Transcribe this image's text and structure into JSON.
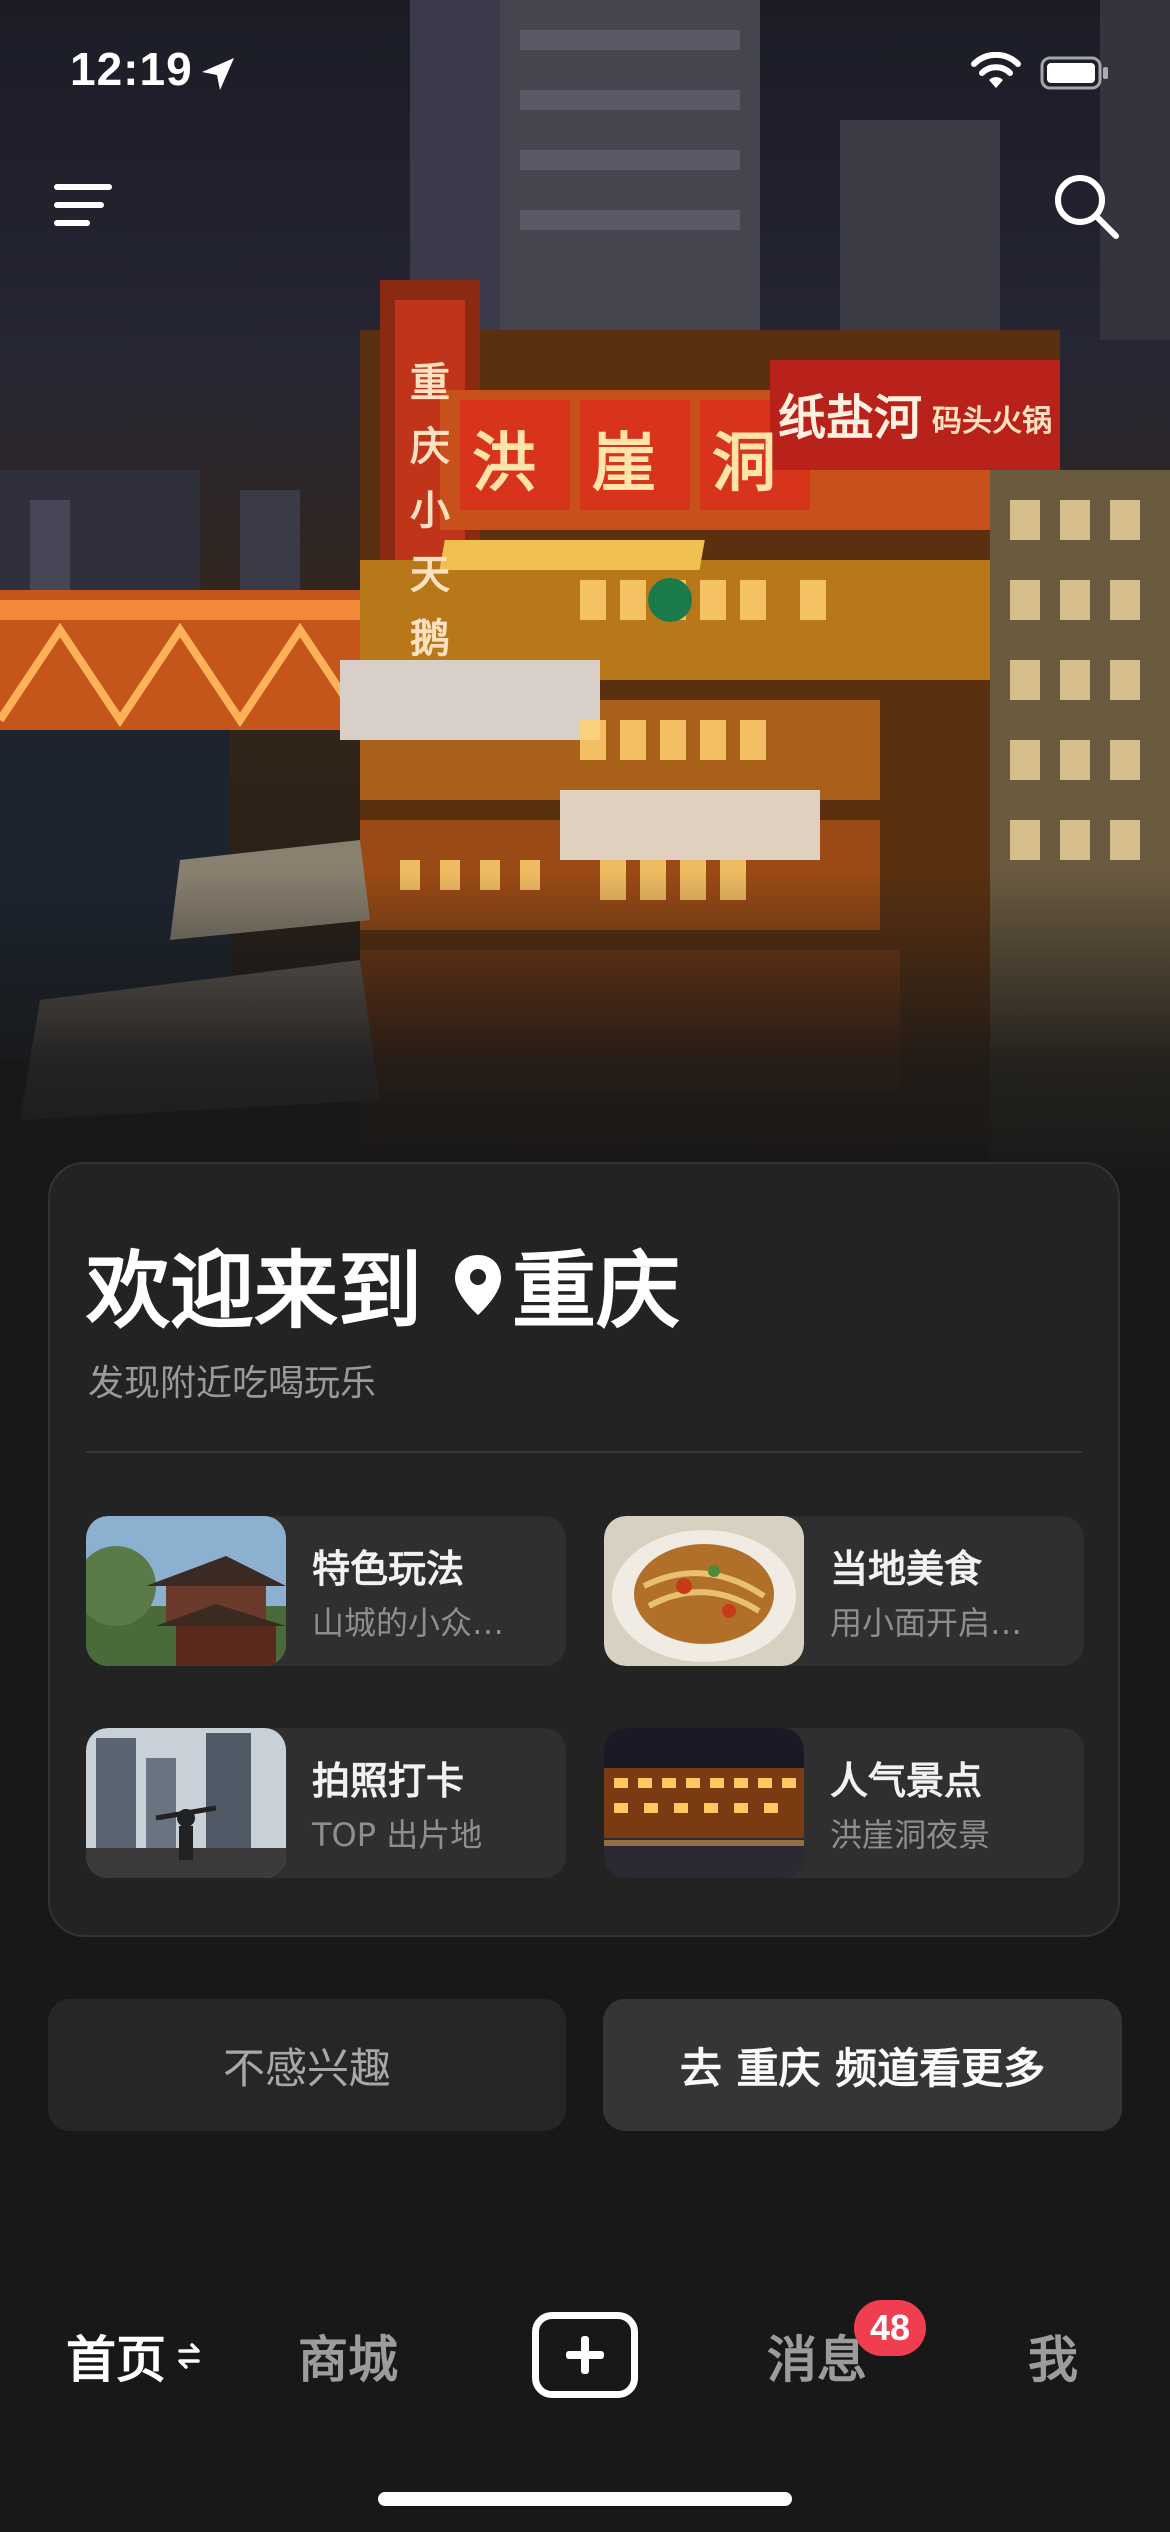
{
  "status_bar": {
    "time": "12:19"
  },
  "header": {
    "menu_icon": "menu-icon",
    "search_icon": "search-icon"
  },
  "hero": {
    "signs": {
      "main": [
        "洪",
        "崖",
        "洞"
      ],
      "vertical": [
        "重",
        "庆",
        "小",
        "天",
        "鹅"
      ],
      "right": "纸盐河",
      "right_small": "码头火锅"
    }
  },
  "welcome": {
    "title_prefix": "欢迎来到",
    "city": "重庆",
    "subtitle": "发现附近吃喝玩乐"
  },
  "categories": [
    {
      "title": "特色玩法",
      "subtitle": "山城的小众…"
    },
    {
      "title": "当地美食",
      "subtitle": "用小面开启…"
    },
    {
      "title": "拍照打卡",
      "subtitle": "TOP 出片地"
    },
    {
      "title": "人气景点",
      "subtitle": "洪崖洞夜景"
    }
  ],
  "actions": {
    "not_interested": "不感兴趣",
    "more": "去 重庆 频道看更多"
  },
  "tabbar": {
    "home": "首页",
    "mall": "商城",
    "messages": "消息",
    "messages_badge": "48",
    "me": "我"
  },
  "colors": {
    "badge": "#f03e50",
    "background": "#181818",
    "card": "#232323"
  }
}
